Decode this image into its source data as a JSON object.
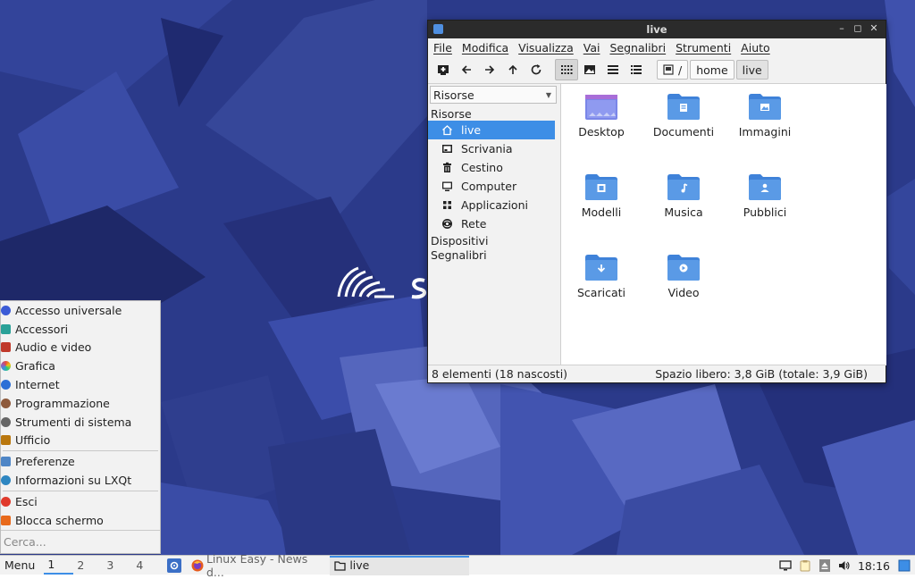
{
  "desktop": {
    "background": "#2b3a8a",
    "logo_icon": "spiral-logo-icon"
  },
  "window": {
    "title": "live",
    "menu": [
      "File",
      "Modifica",
      "Visualizza",
      "Vai",
      "Segnalibri",
      "Strumenti",
      "Aiuto"
    ],
    "path": [
      "/",
      "home",
      "live"
    ],
    "sidebar": {
      "combo_value": "Risorse",
      "section_places": "Risorse",
      "places": [
        {
          "label": "live",
          "icon": "home-icon",
          "selected": true
        },
        {
          "label": "Scrivania",
          "icon": "desktop-icon",
          "selected": false
        },
        {
          "label": "Cestino",
          "icon": "trash-icon",
          "selected": false
        },
        {
          "label": "Computer",
          "icon": "computer-icon",
          "selected": false
        },
        {
          "label": "Applicazioni",
          "icon": "apps-icon",
          "selected": false
        },
        {
          "label": "Rete",
          "icon": "network-icon",
          "selected": false
        }
      ],
      "section_devices": "Dispositivi",
      "section_bookmarks": "Segnalibri"
    },
    "files": [
      {
        "name": "Desktop",
        "icon": "desktop-folder-icon"
      },
      {
        "name": "Documenti",
        "icon": "documents-folder-icon"
      },
      {
        "name": "Immagini",
        "icon": "pictures-folder-icon"
      },
      {
        "name": "Modelli",
        "icon": "templates-folder-icon"
      },
      {
        "name": "Musica",
        "icon": "music-folder-icon"
      },
      {
        "name": "Pubblici",
        "icon": "public-folder-icon"
      },
      {
        "name": "Scaricati",
        "icon": "downloads-folder-icon"
      },
      {
        "name": "Video",
        "icon": "videos-folder-icon"
      }
    ],
    "status_left": "8 elementi (18 nascosti)",
    "status_right": "Spazio libero: 3,8 GiB (totale: 3,9 GiB)"
  },
  "start_menu": {
    "groups": [
      [
        {
          "label": "Accesso universale",
          "color": "#3b5bd6"
        },
        {
          "label": "Accessori",
          "color": "#2aa198"
        },
        {
          "label": "Audio e video",
          "color": "#c0392b"
        },
        {
          "label": "Grafica",
          "color": "#e67e22"
        },
        {
          "label": "Internet",
          "color": "#2c6fd6"
        },
        {
          "label": "Programmazione",
          "color": "#8e5a3c"
        },
        {
          "label": "Strumenti di sistema",
          "color": "#666666"
        },
        {
          "label": "Ufficio",
          "color": "#b9770e"
        }
      ],
      [
        {
          "label": "Preferenze",
          "color": "#4f86c6"
        },
        {
          "label": "Informazioni su LXQt",
          "color": "#2e86c1"
        }
      ],
      [
        {
          "label": "Esci",
          "color": "#e03a2c"
        },
        {
          "label": "Blocca schermo",
          "color": "#e86a1c"
        }
      ]
    ],
    "search_placeholder": "Cerca..."
  },
  "taskbar": {
    "menu_label": "Menu",
    "workspaces": [
      "1",
      "2",
      "3",
      "4"
    ],
    "tasks": [
      {
        "label": "Linux Easy - News d...",
        "icon": "firefox-icon",
        "active": false
      },
      {
        "label": "live",
        "icon": "folder-icon",
        "active": true
      }
    ],
    "clock": "18:16"
  }
}
